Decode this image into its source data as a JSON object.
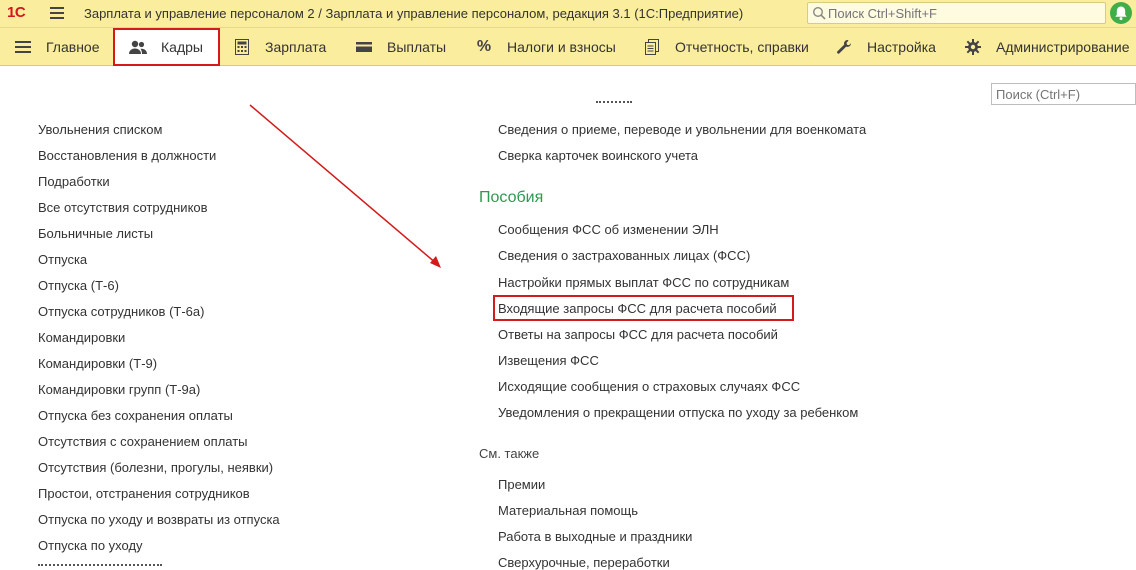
{
  "titlebar": {
    "logo": "1С",
    "title": "Зарплата и управление персоналом 2 / Зарплата и управление персоналом, редакция 3.1  (1С:Предприятие)",
    "search_placeholder": "Поиск Ctrl+Shift+F"
  },
  "sections": {
    "main": "Главное",
    "hr": "Кадры",
    "salary": "Зарплата",
    "payments": "Выплаты",
    "taxes": "Налоги и взносы",
    "reports": "Отчетность, справки",
    "settings": "Настройка",
    "admin": "Администрирование"
  },
  "content_search_placeholder": "Поиск (Ctrl+F)",
  "left_links": [
    "Увольнения списком",
    "Восстановления в должности",
    "Подработки",
    "Все отсутствия сотрудников",
    "Больничные листы",
    "Отпуска",
    "Отпуска (Т-6)",
    "Отпуска сотрудников (Т-6а)",
    "Командировки",
    "Командировки (Т-9)",
    "Командировки групп (Т-9а)",
    "Отпуска без сохранения оплаты",
    "Отсутствия с сохранением оплаты",
    "Отсутствия (болезни, прогулы, неявки)",
    "Простои, отстранения сотрудников",
    "Отпуска по уходу и возвраты из отпуска",
    "Отпуска по уходу"
  ],
  "military_links": [
    "Сведения о приеме, переводе и увольнении для военкомата",
    "Сверка карточек воинского учета"
  ],
  "benefits": {
    "title": "Пособия",
    "links": [
      "Сообщения ФСС об изменении ЭЛН",
      "Сведения о застрахованных лицах (ФСС)",
      "Настройки прямых выплат ФСС по сотрудникам",
      "Входящие запросы ФСС для расчета пособий",
      "Ответы на запросы ФСС для расчета пособий",
      "Извещения ФСС",
      "Исходящие сообщения о страховых случаях ФСС",
      "Уведомления о прекращении отпуска по уходу за ребенком"
    ]
  },
  "see_also": {
    "title": "См. также",
    "links": [
      "Премии",
      "Материальная помощь",
      "Работа в выходные и праздники",
      "Сверхурочные, переработки"
    ]
  },
  "colors": {
    "bar": "#fbed9e",
    "accent_red": "#d41a1a",
    "group_green": "#2e9a4f"
  },
  "icons": [
    "hamburger-icon",
    "search-icon",
    "bell-icon",
    "list-icon",
    "people-icon",
    "calculator-icon",
    "wallet-icon",
    "percent-icon",
    "documents-icon",
    "wrench-icon",
    "gear-icon"
  ]
}
